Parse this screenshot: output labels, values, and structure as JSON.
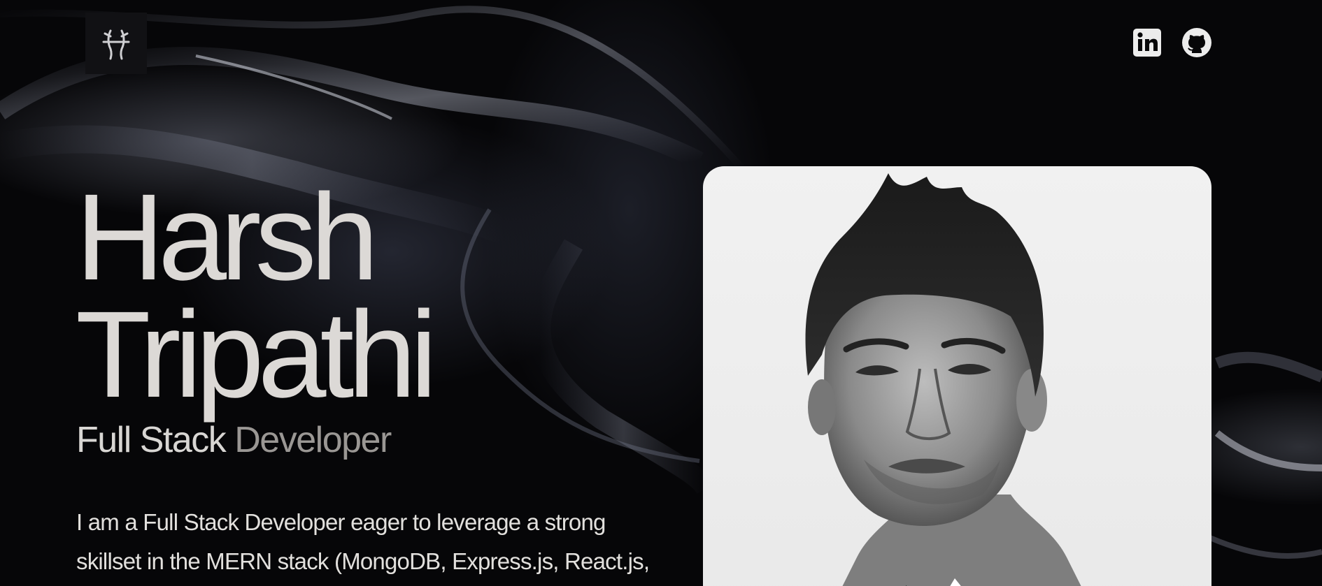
{
  "header": {
    "logo_icon": "monogram-logo-icon",
    "social": [
      {
        "name": "LinkedIn",
        "icon": "linkedin-icon"
      },
      {
        "name": "GitHub",
        "icon": "github-icon"
      }
    ]
  },
  "hero": {
    "first_name": "Harsh",
    "last_name": "Tripathi",
    "role_part1": "Full Stack",
    "role_part2": "Developer",
    "bio_line1": "I am a Full Stack Developer eager to leverage a strong",
    "bio_line2": "skillset in the MERN stack (MongoDB, Express.js, React.js,"
  },
  "photo": {
    "icon": "portrait-photo"
  },
  "colors": {
    "background": "#060608",
    "text_primary": "#dcd9d6",
    "text_muted": "#9a9794",
    "card_bg": "#efefef"
  }
}
